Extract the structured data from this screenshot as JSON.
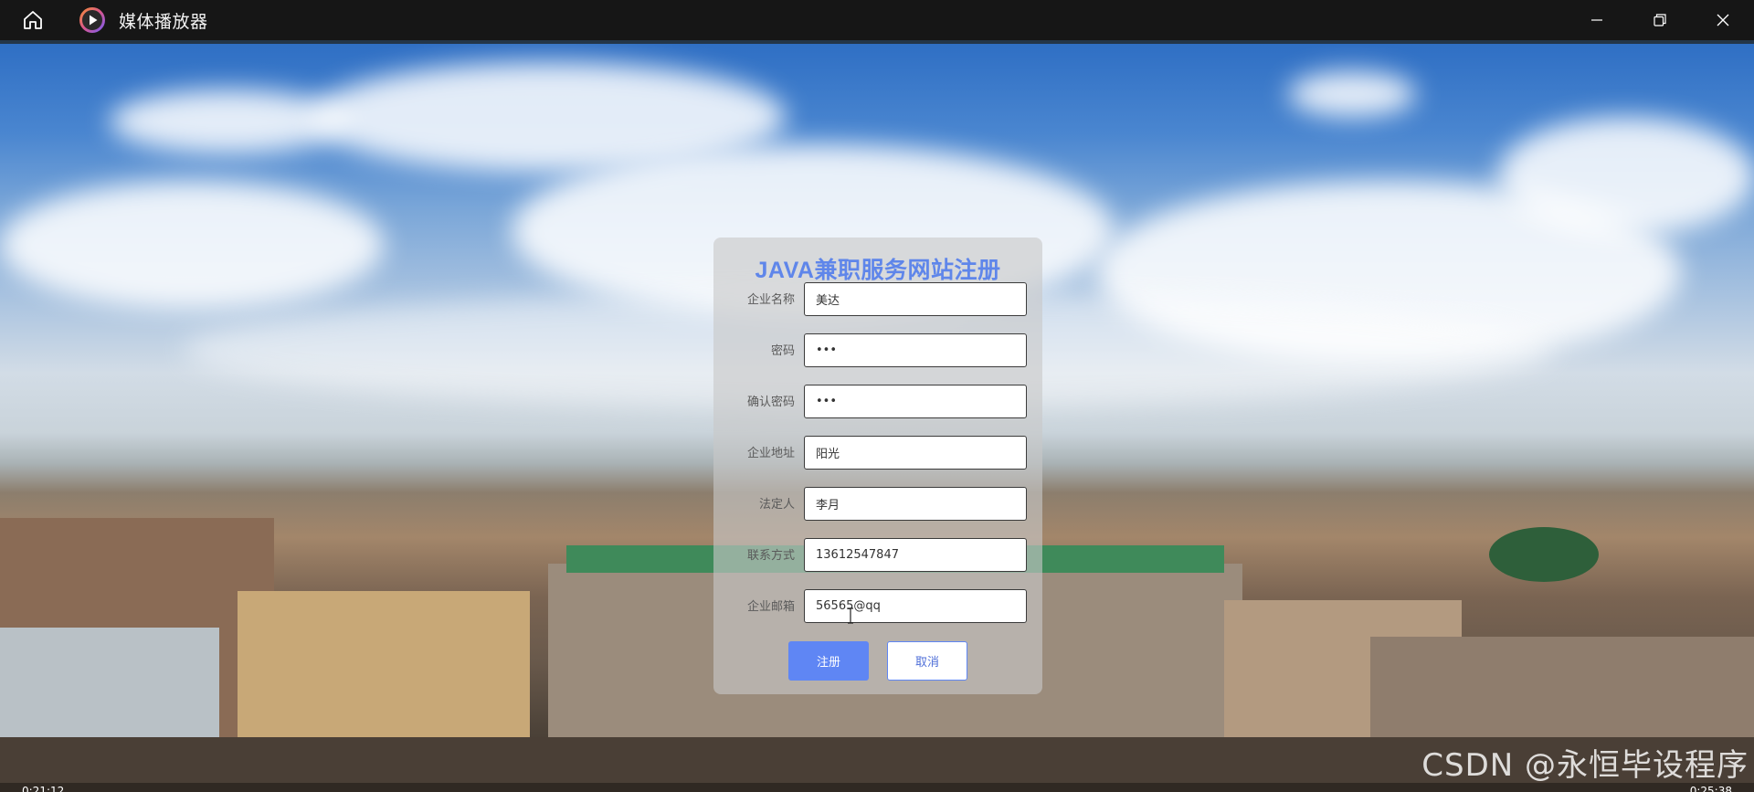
{
  "window": {
    "title": "媒体播放器"
  },
  "form": {
    "title": "JAVA兼职服务网站注册",
    "fields": [
      {
        "label": "企业名称",
        "value": "美达"
      },
      {
        "label": "密码",
        "value": "•••"
      },
      {
        "label": "确认密码",
        "value": "•••"
      },
      {
        "label": "企业地址",
        "value": "阳光"
      },
      {
        "label": "法定人",
        "value": "李月"
      },
      {
        "label": "联系方式",
        "value": "13612547847"
      },
      {
        "label": "企业邮箱",
        "value": "56565@qq"
      }
    ],
    "register_label": "注册",
    "cancel_label": "取消"
  },
  "watermark": "CSDN @永恒毕设程序",
  "player": {
    "time_current": "0:21:12",
    "time_total": "0:25:38"
  },
  "colors": {
    "titlebar_bg": "#161616",
    "form_title": "#5f86ea",
    "primary_button": "#5f86f4"
  },
  "icons": {
    "home": "home-icon",
    "app": "play-circle-icon",
    "minimize": "minimize-icon",
    "restore": "restore-icon",
    "close": "close-icon"
  }
}
